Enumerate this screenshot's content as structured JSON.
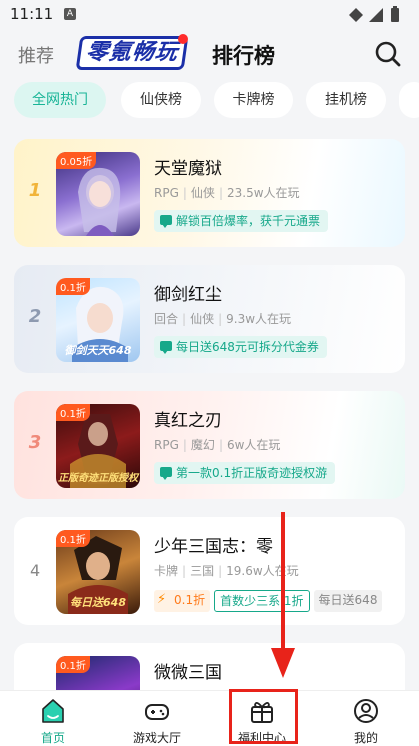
{
  "status": {
    "time": "11:11",
    "notif_letter": "A"
  },
  "topnav": {
    "recommend_label": "推荐",
    "logo_text": "零氪畅玩",
    "rank_label": "排行榜"
  },
  "chips": [
    "全网热门",
    "仙侠榜",
    "卡牌榜",
    "挂机榜"
  ],
  "games": [
    {
      "rank": "1",
      "title": "天堂魔狱",
      "meta": [
        "RPG",
        "仙侠",
        "23.5w人在玩"
      ],
      "tag": "解锁百倍爆率，获千元通票",
      "discount": "0.05折",
      "caption": ""
    },
    {
      "rank": "2",
      "title": "御剑红尘",
      "meta": [
        "回合",
        "仙侠",
        "9.3w人在玩"
      ],
      "tag": "每日送648元可拆分代金券",
      "discount": "0.1折",
      "caption": "御剑天天648"
    },
    {
      "rank": "3",
      "title": "真红之刃",
      "meta": [
        "RPG",
        "魔幻",
        "6w人在玩"
      ],
      "tag": "第一款0.1折正版奇迹授权游",
      "discount": "0.1折",
      "caption": "正版奇迹正版授权"
    },
    {
      "rank": "4",
      "title": "少年三国志：零",
      "meta": [
        "卡牌",
        "三国",
        "19.6w人在玩"
      ],
      "price_tag": "0.1折",
      "tag2": "首数少三系.1折",
      "tag3": "每日送648",
      "discount": "0.1折",
      "caption": "每日送648"
    },
    {
      "rank": "5",
      "title": "微微三国",
      "meta": [],
      "discount": "0.1折",
      "caption": ""
    }
  ],
  "bottomnav": [
    {
      "label": "首页",
      "icon": "home-icon",
      "active": true
    },
    {
      "label": "游戏大厅",
      "icon": "gamepad-icon",
      "active": false
    },
    {
      "label": "福利中心",
      "icon": "gift-icon",
      "active": false
    },
    {
      "label": "我的",
      "icon": "profile-icon",
      "active": false
    }
  ],
  "colors": {
    "accent": "#16a88a",
    "annotation": "#e8231a",
    "logo_blue": "#1b2fa8"
  }
}
